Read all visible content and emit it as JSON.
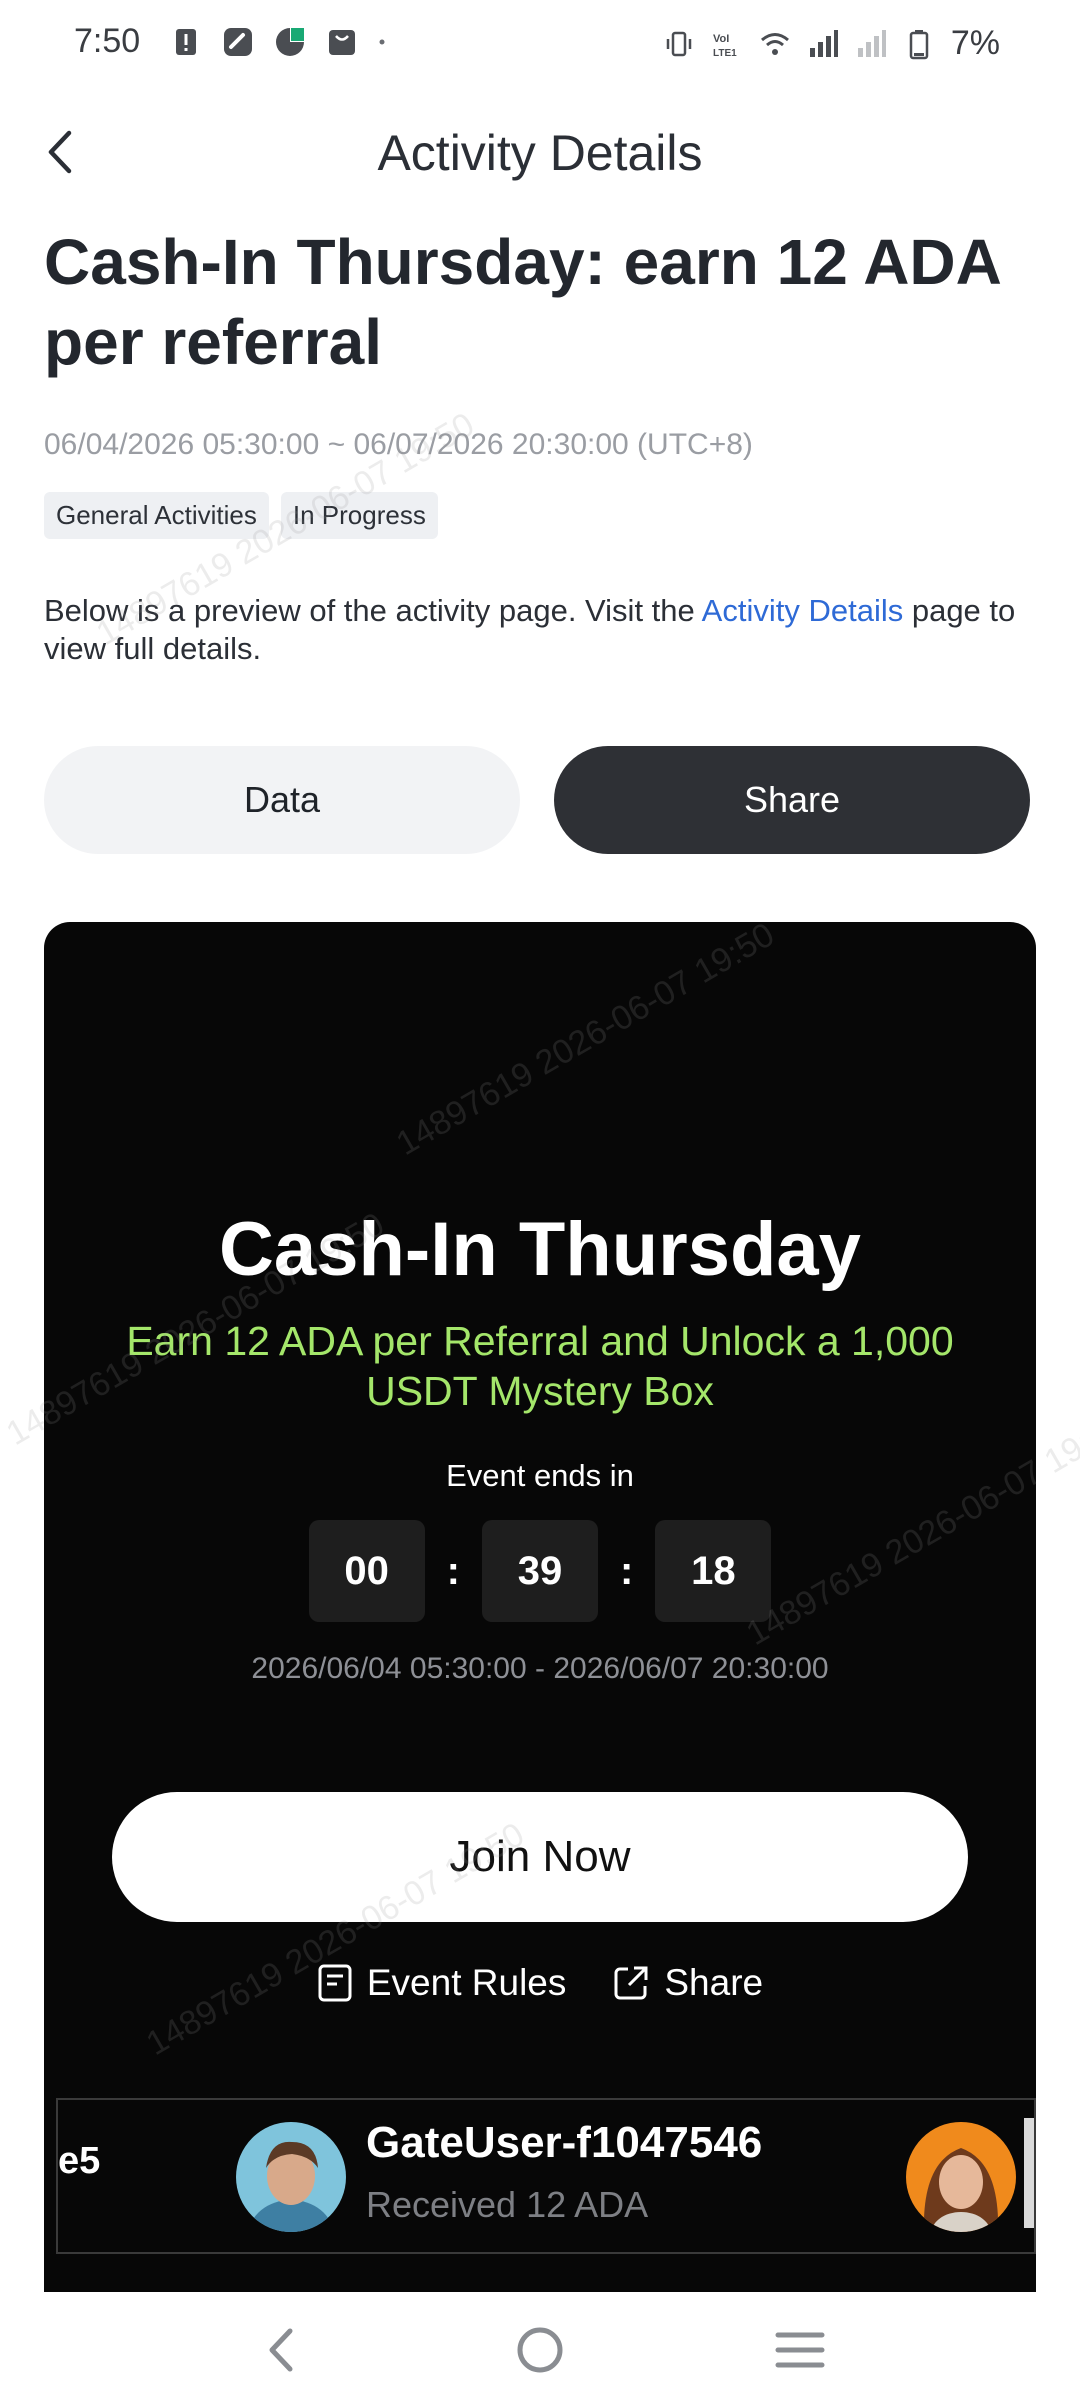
{
  "status_bar": {
    "time": "7:50",
    "battery_percent": "7%",
    "left_icons": [
      "alert-icon",
      "app-icon",
      "gate-app-icon",
      "bag-icon",
      "dot-icon"
    ],
    "right_icons": [
      "vibrate-icon",
      "volte-icon",
      "wifi-icon",
      "signal-icon",
      "signal-weak-icon",
      "battery-icon"
    ]
  },
  "header": {
    "title": "Activity Details"
  },
  "event": {
    "title": "Cash-In Thursday: earn 12 ADA per referral",
    "dates": "06/04/2026 05:30:00 ~ 06/07/2026 20:30:00 (UTC+8)",
    "tags": [
      "General Activities",
      "In Progress"
    ],
    "preview_prefix": "Below is a preview of the activity page. Visit the ",
    "preview_link": "Activity Details",
    "preview_suffix": " page to view full details."
  },
  "actions": {
    "data_label": "Data",
    "share_label": "Share"
  },
  "card": {
    "title": "Cash-In Thursday",
    "subtitle": "Earn 12 ADA per Referral and Unlock a 1,000 USDT Mystery Box",
    "ends_label": "Event ends in",
    "countdown": {
      "hours": "00",
      "minutes": "39",
      "seconds": "18",
      "separator": ":"
    },
    "range": "2026/06/04 05:30:00 - 2026/06/07 20:30:00",
    "join_label": "Join Now",
    "rules_label": "Event Rules",
    "share_label": "Share",
    "ticker": {
      "prev_fragment": "e5",
      "user_name": "GateUser-f1047546",
      "user_status": "Received 12 ADA"
    }
  },
  "watermark": "14897619 2026-06-07 19:50",
  "colors": {
    "accent_link": "#2e6ad6",
    "subtitle_green": "#a4e66a",
    "card_bg": "#070707",
    "share_button_bg": "#2e3035"
  }
}
